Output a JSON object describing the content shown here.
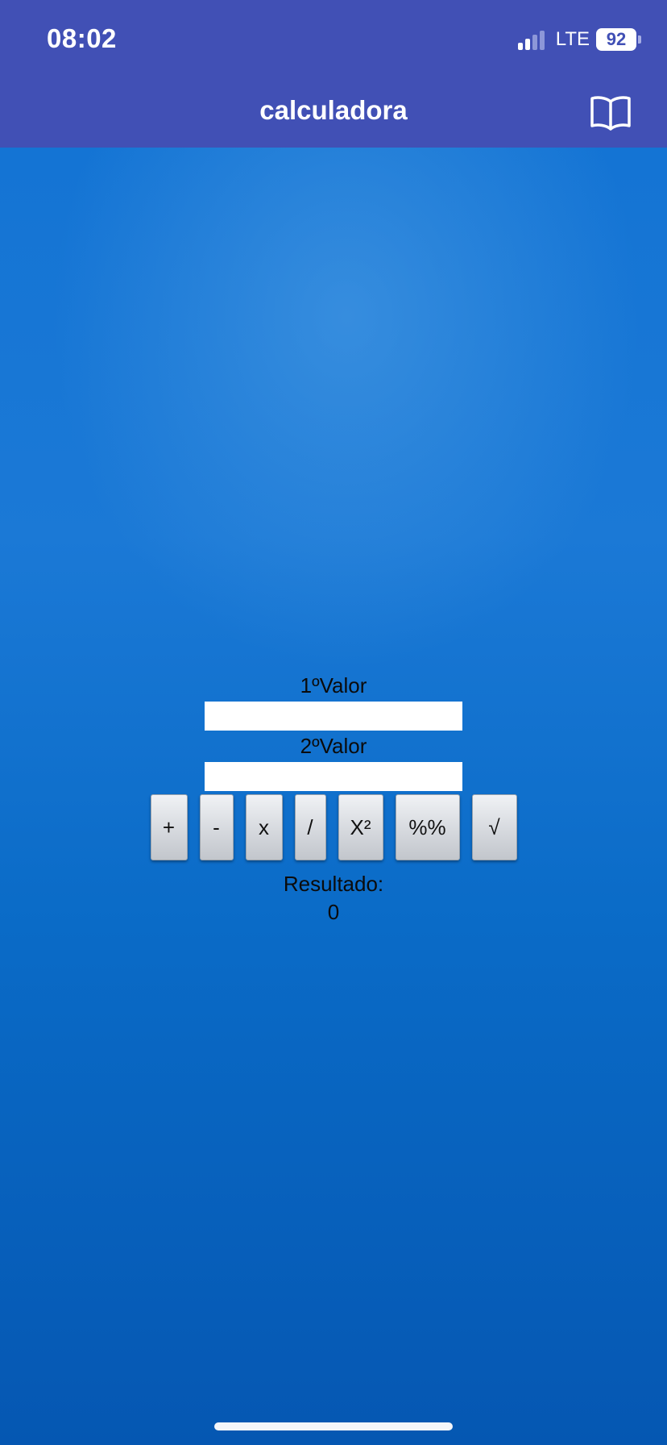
{
  "status_bar": {
    "time": "08:02",
    "network": "LTE",
    "battery": "92"
  },
  "header": {
    "title": "calculadora",
    "icon": "book-icon"
  },
  "form": {
    "first_label": "1ºValor",
    "first_value": "",
    "second_label": "2ºValor",
    "second_value": ""
  },
  "operations": [
    {
      "label": "+"
    },
    {
      "label": "-"
    },
    {
      "label": "x"
    },
    {
      "label": "/"
    },
    {
      "label": "X²"
    },
    {
      "label": "%%"
    },
    {
      "label": "√"
    }
  ],
  "result": {
    "label": "Resultado:",
    "value": "0"
  },
  "colors": {
    "header_bg": "#4150b5",
    "content_bg": "#0766c4"
  }
}
